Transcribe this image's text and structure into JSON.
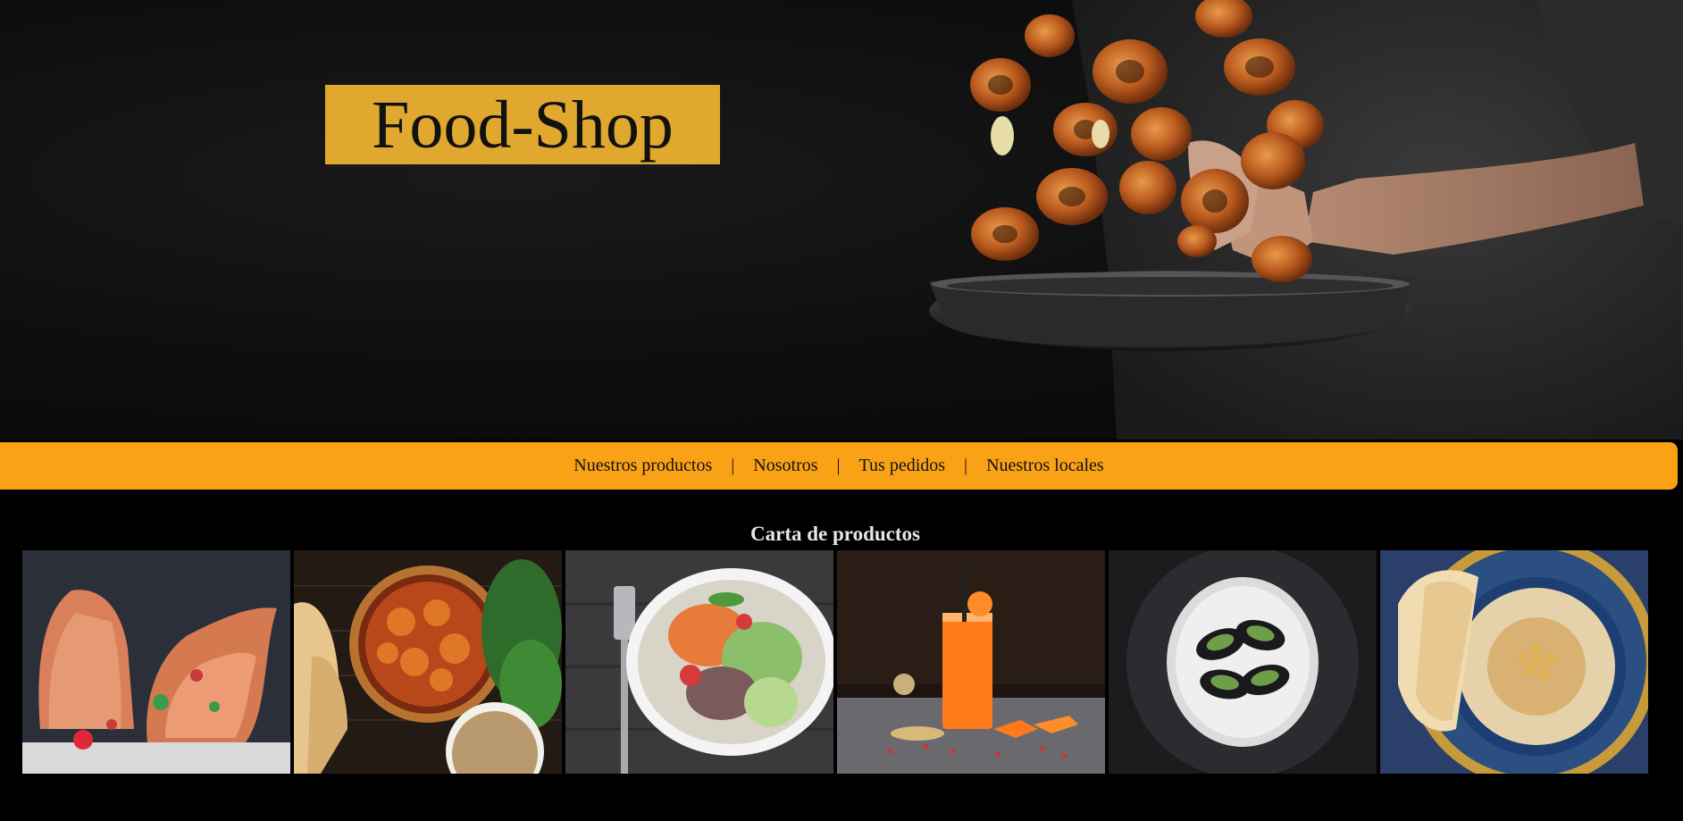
{
  "header": {
    "logo_text": "Food-Shop",
    "logo_bg": "#e0a82e"
  },
  "nav": {
    "bg": "#faa216",
    "separator": "|",
    "items": [
      {
        "label": "Nuestros productos"
      },
      {
        "label": "Nosotros"
      },
      {
        "label": "Tus pedidos"
      },
      {
        "label": "Nuestros locales"
      }
    ]
  },
  "catalog": {
    "title": "Carta de productos",
    "products": [
      {
        "image": "bread-image"
      },
      {
        "image": "curry-image"
      },
      {
        "image": "salad-bowl-image"
      },
      {
        "image": "carrot-juice-image"
      },
      {
        "image": "mussels-image"
      },
      {
        "image": "hummus-image"
      }
    ]
  }
}
